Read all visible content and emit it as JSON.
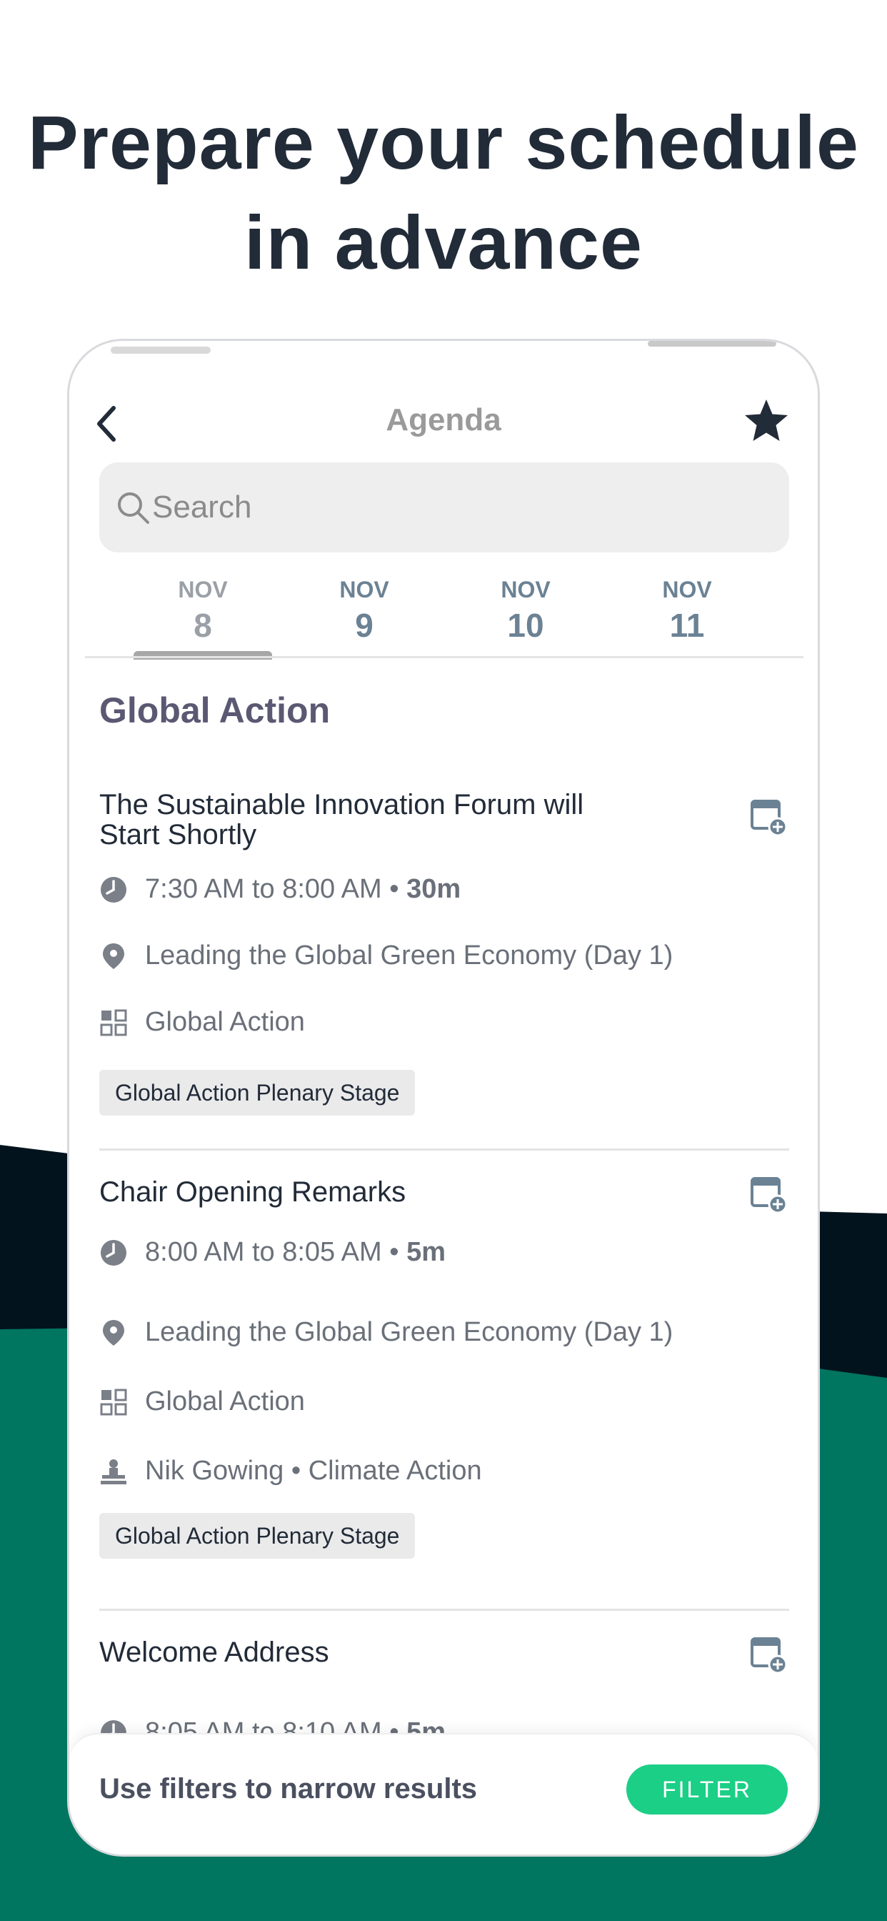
{
  "promo": {
    "headline_line1": "Prepare your schedule",
    "headline_line2": "in advance"
  },
  "header": {
    "title": "Agenda"
  },
  "search": {
    "placeholder": "Search",
    "value": ""
  },
  "date_tabs": [
    {
      "month": "NOV",
      "day": "8",
      "selected": true
    },
    {
      "month": "NOV",
      "day": "9",
      "selected": false
    },
    {
      "month": "NOV",
      "day": "10",
      "selected": false
    },
    {
      "month": "NOV",
      "day": "11",
      "selected": false
    }
  ],
  "section": {
    "title": "Global Action"
  },
  "sessions": [
    {
      "title_line1": "The Sustainable Innovation Forum will",
      "title_line2": "Start Shortly",
      "time": "7:30 AM to 8:00 AM •",
      "duration": "30m",
      "location": "Leading the Global Green Economy (Day 1)",
      "track": "Global Action",
      "stage": "Global Action Plenary Stage"
    },
    {
      "title": "Chair Opening Remarks",
      "time": "8:00 AM to 8:05 AM •",
      "duration": "5m",
      "location": "Leading the Global Green Economy (Day 1)",
      "track": "Global Action",
      "speaker": "Nik Gowing • Climate Action",
      "stage": "Global Action Plenary Stage"
    },
    {
      "title": "Welcome Address",
      "time": "8:05 AM to 8:10 AM •",
      "duration": "5m"
    }
  ],
  "bottom_bar": {
    "text": "Use filters to narrow results",
    "filter_label": "FILTER"
  },
  "colors": {
    "headline": "#222b38",
    "dark_shape": "#03131d",
    "teal_shape": "#007560",
    "accent_green": "#1bcf86",
    "section_title": "#5a5872",
    "tab_muted": "#9aa0a6",
    "tab_blue": "#6b8294",
    "icon_gray": "#7a7f88"
  },
  "icons": [
    "back-chevron-icon",
    "star-icon",
    "search-icon",
    "add-to-calendar-icon",
    "clock-icon",
    "location-pin-icon",
    "grid-icon",
    "speaker-podium-icon"
  ]
}
